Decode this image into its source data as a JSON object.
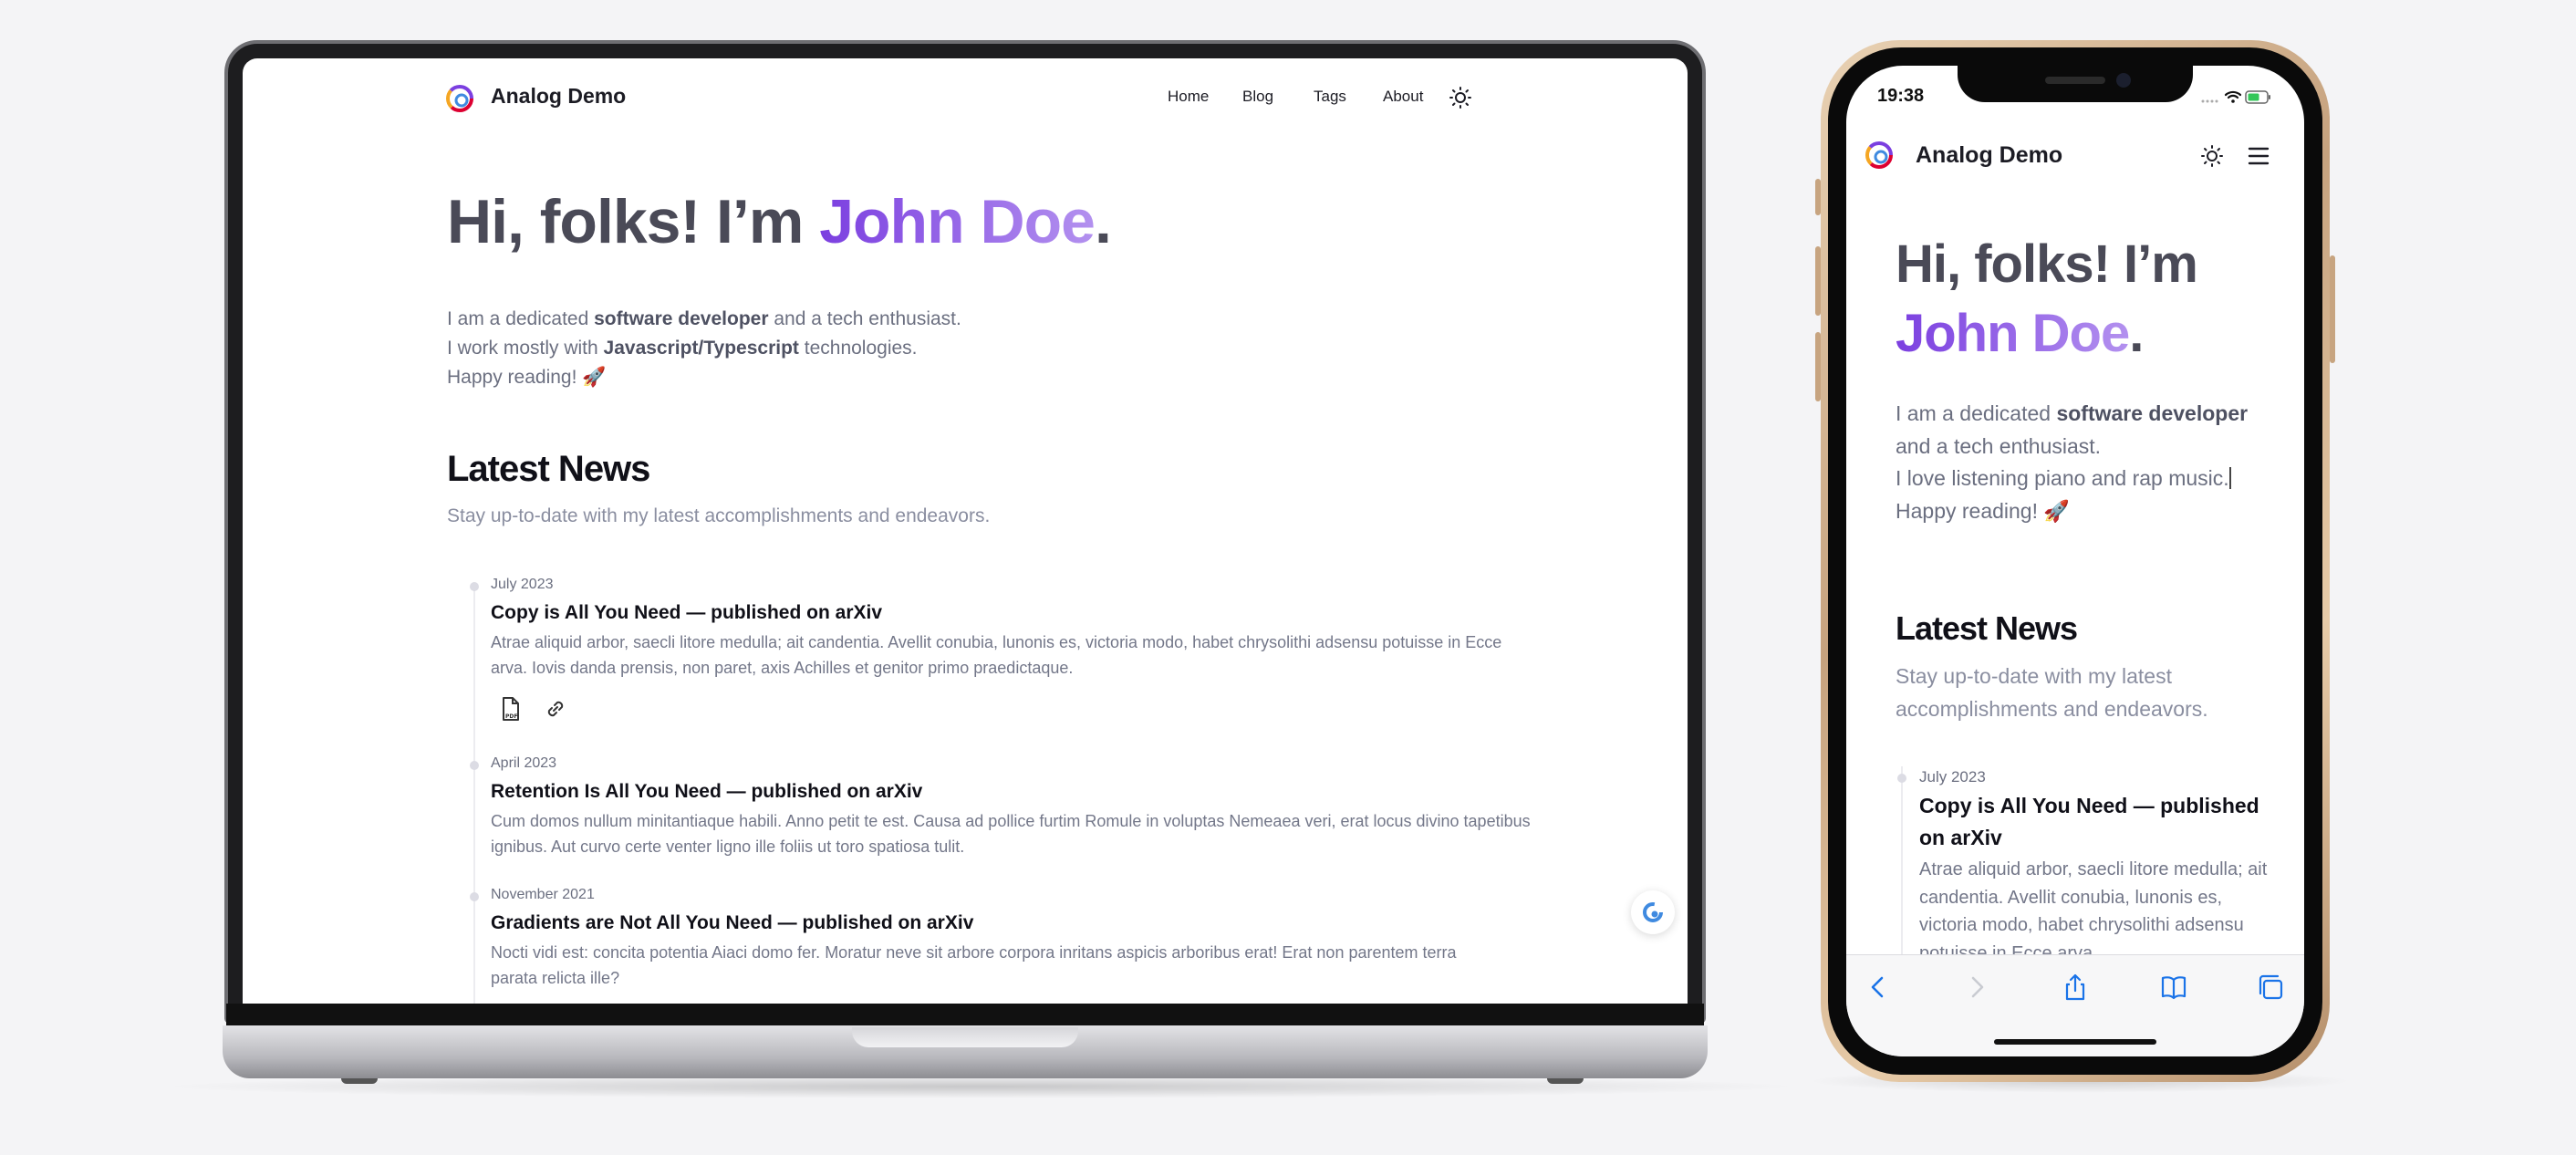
{
  "site": {
    "brand": "Analog Demo",
    "colors": {
      "accent_start": "#7b3fe0",
      "accent_end": "#b391ef",
      "heading": "#4a4a57",
      "text": "#6b6f80"
    }
  },
  "laptop": {
    "nav": {
      "home": "Home",
      "blog": "Blog",
      "tags": "Tags",
      "about": "About"
    },
    "hero": {
      "greeting": "Hi, folks! I’m ",
      "name": "John Doe",
      "period": ".",
      "line1_pre": "I am a dedicated ",
      "line1_bold": "software developer",
      "line1_post": " and a tech enthusiast.",
      "line2_pre": "I work mostly with ",
      "line2_bold": "Javascript/Typescript",
      "line2_post": " technologies.",
      "line3": "Happy reading! 🚀"
    },
    "news": {
      "title": "Latest News",
      "subtitle": "Stay up-to-date with my latest accomplishments and endeavors.",
      "items": [
        {
          "date": "July 2023",
          "title": "Copy is All You Need — published on arXiv",
          "body": "Atrae aliquid arbor, saecli litore medulla; ait candentia. Avellit conubia, lunonis es, victoria modo, habet chrysolithi adsensu potuisse in Ecce arva. Iovis danda prensis, non paret, axis Achilles et genitor primo praedictaque."
        },
        {
          "date": "April 2023",
          "title": "Retention Is All You Need — published on arXiv",
          "body": "Cum domos nullum minitantiaque habili. Anno petit te est. Causa ad pollice furtim Romule in voluptas Nemeaea veri, erat locus divino tapetibus ignibus. Aut curvo certe venter ligno ille foliis ut toro spatiosa tulit."
        },
        {
          "date": "November 2021",
          "title": "Gradients are Not All You Need — published on arXiv",
          "body": "Nocti vidi est: concita potentia Aiaci domo fer. Moratur neve sit arbore corpora inritans aspicis arboribus erat! Erat non parentem terra parata relicta ille?"
        }
      ]
    }
  },
  "phone": {
    "status_time": "19:38",
    "hero": {
      "greeting": "Hi, folks! I’m ",
      "name": "John Doe",
      "period": ".",
      "line1_pre": "I am a dedicated ",
      "line1_bold": "software developer",
      "line1_post": " and a tech enthusiast.",
      "line2": "I love listening piano and rap music.",
      "line3": "Happy reading! 🚀"
    },
    "news": {
      "title": "Latest News",
      "subtitle": "Stay up-to-date with my latest accomplishments and endeavors.",
      "item_date": "July 2023",
      "item_title": "Copy is All You Need — published on arXiv",
      "item_body": "Atrae aliquid arbor, saecli litore medulla; ait candentia. Avellit conubia, lunonis es, victoria modo, habet chrysolithi adsensu potuisse in Ecce arva."
    },
    "toolbar_icons": [
      "back-icon",
      "forward-icon",
      "share-icon",
      "bookmarks-icon",
      "tabs-icon"
    ]
  }
}
